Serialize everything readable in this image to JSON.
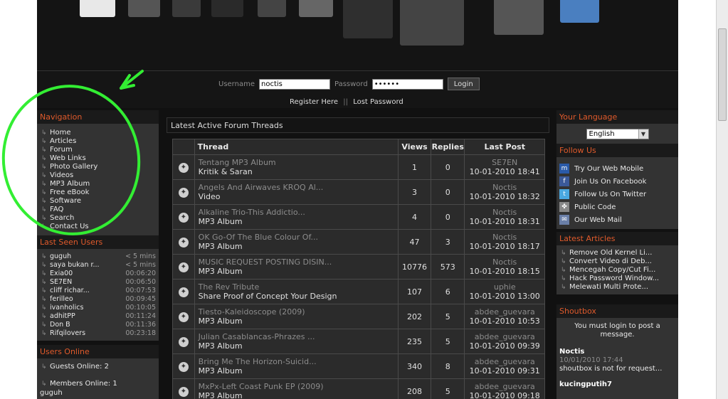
{
  "colors": {
    "accent": "#e05a2b",
    "annotation": "#33ee33",
    "panel": "#333333",
    "background": "#111111"
  },
  "login": {
    "username_label": "Username",
    "username_value": "noctis",
    "password_label": "Password",
    "password_value": "••••••",
    "login_button": "Login",
    "register_link": "Register Here",
    "separator": "||",
    "lost_password_link": "Lost Password"
  },
  "navigation": {
    "title": "Navigation",
    "items": [
      "Home",
      "Articles",
      "Forum",
      "Web Links",
      "Photo Gallery",
      "Videos",
      "MP3 Album",
      "Free eBook",
      "Software",
      "FAQ",
      "Search",
      "Contact Us"
    ]
  },
  "last_seen": {
    "title": "Last Seen Users",
    "users": [
      {
        "name": "guguh",
        "time": "< 5 mins"
      },
      {
        "name": "saya bukan r...",
        "time": "< 5 mins"
      },
      {
        "name": "Exia00",
        "time": "00:06:20"
      },
      {
        "name": "SE7EN",
        "time": "00:06:50"
      },
      {
        "name": "cliff richar...",
        "time": "00:07:53"
      },
      {
        "name": "ferilleo",
        "time": "00:09:45"
      },
      {
        "name": "ivanholics",
        "time": "00:10:05"
      },
      {
        "name": "adhitPP",
        "time": "00:11:24"
      },
      {
        "name": "Don B",
        "time": "00:11:36"
      },
      {
        "name": "Rifqilovers",
        "time": "00:23:18"
      }
    ]
  },
  "users_online": {
    "title": "Users Online",
    "guests": "Guests Online: 2",
    "members": "Members Online: 1",
    "member_name": "guguh"
  },
  "threads": {
    "title": "Latest Active Forum Threads",
    "headers": {
      "thread": "Thread",
      "views": "Views",
      "replies": "Replies",
      "last_post": "Last Post"
    },
    "rows": [
      {
        "title": "Tentang MP3 Album",
        "forum": "Kritik & Saran",
        "views": "1",
        "replies": "0",
        "user": "SE7EN",
        "date": "10-01-2010 18:41"
      },
      {
        "title": "Angels And Airwaves KROQ Al...",
        "forum": "Video",
        "views": "3",
        "replies": "0",
        "user": "Noctis",
        "date": "10-01-2010 18:32"
      },
      {
        "title": "Alkaline Trio-This Addictio...",
        "forum": "MP3 Album",
        "views": "4",
        "replies": "0",
        "user": "Noctis",
        "date": "10-01-2010 18:31"
      },
      {
        "title": "OK Go-Of The Blue Colour Of...",
        "forum": "MP3 Album",
        "views": "47",
        "replies": "3",
        "user": "Noctis",
        "date": "10-01-2010 18:17"
      },
      {
        "title": "MUSIC REQUEST POSTING DISIN...",
        "forum": "MP3 Album",
        "views": "10776",
        "replies": "573",
        "user": "Noctis",
        "date": "10-01-2010 18:15"
      },
      {
        "title": "The Rev Tribute",
        "forum": "Share Proof of Concept Your Design",
        "views": "107",
        "replies": "6",
        "user": "uphie",
        "date": "10-01-2010 13:00"
      },
      {
        "title": "Tiesto-Kaleidoscope (2009)",
        "forum": "MP3 Album",
        "views": "202",
        "replies": "5",
        "user": "abdee_guevara",
        "date": "10-01-2010 10:53"
      },
      {
        "title": "Julian Casablancas-Phrazes ...",
        "forum": "MP3 Album",
        "views": "235",
        "replies": "5",
        "user": "abdee_guevara",
        "date": "10-01-2010 09:39"
      },
      {
        "title": "Bring Me The Horizon-Suicid...",
        "forum": "MP3 Album",
        "views": "340",
        "replies": "8",
        "user": "abdee_guevara",
        "date": "10-01-2010 09:31"
      },
      {
        "title": "MxPx-Left Coast Punk EP (2009)",
        "forum": "MP3 Album",
        "views": "208",
        "replies": "5",
        "user": "abdee_guevara",
        "date": "10-01-2010 09:18"
      }
    ]
  },
  "language": {
    "title": "Your Language",
    "selected": "English"
  },
  "follow_us": {
    "title": "Follow Us",
    "items": [
      {
        "label": "Try Our Web Mobile",
        "icon": "mobile-icon"
      },
      {
        "label": "Join Us On Facebook",
        "icon": "facebook-icon"
      },
      {
        "label": "Follow Us On Twitter",
        "icon": "twitter-icon"
      },
      {
        "label": "Public Code",
        "icon": "code-icon"
      },
      {
        "label": "Our Web Mail",
        "icon": "mail-icon"
      }
    ]
  },
  "latest_articles": {
    "title": "Latest Articles",
    "items": [
      "Remove Old Kernel Li...",
      "Convert Video di Deb...",
      "Mencegah Copy/Cut Fi...",
      "Hack Password Window...",
      "Melewati Multi Prote..."
    ]
  },
  "shoutbox": {
    "title": "Shoutbox",
    "message": "You must login to post a message.",
    "posts": [
      {
        "name": "Noctis",
        "date": "10/01/2010 17:44",
        "text": "shoutbox is not for request..."
      },
      {
        "name": "kucingputih7",
        "date": "",
        "text": ""
      }
    ]
  }
}
